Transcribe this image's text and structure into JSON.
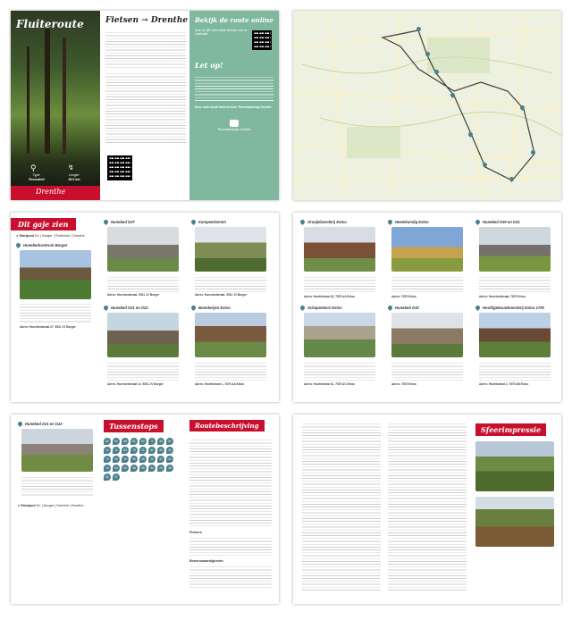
{
  "page1": {
    "cover_title": "Fluiteroute",
    "header_title": "Fietsen → Drenthe",
    "online_title": "Bekijk de route online",
    "online_text": "Scan de QR-code met je telefoon voor de routekaart.",
    "letop_title": "Let op!",
    "green_text": "Deze route wordt beheerd door: Recreatieschap Drenthe",
    "logo_text": "Recreatieschap Drenthe",
    "type_label": "Type:",
    "type_value": "Recreatief",
    "length_label": "Lengte:",
    "length_value": "45.0 km",
    "footer_logo": "Drenthe",
    "colors": {
      "red": "#c8102e",
      "green": "#7fb89f",
      "dark": "#1a1a1a"
    },
    "icons": [
      "bike-icon",
      "route-icon",
      "qr-code"
    ]
  },
  "page3": {
    "title": "Dit gaje zien",
    "start_label": "Startpunt",
    "start_place": "Dr. | Borger | Fluiteilme | Drenthe",
    "items": [
      {
        "title": "Hunebedcentrum Borger",
        "addr": "Adres: Hunebedstraat 27, 9531 JV Borger"
      },
      {
        "title": "Hunebed D27",
        "addr": "Adres: Hunebedstraat, 9531 JV Borger"
      },
      {
        "title": "Kampeerterrein",
        "addr": "Adres: Hunebedstraat, 9531 JV Borger"
      },
      {
        "title": "Hunebed D21 en D22",
        "addr": "Adres: Hunebedstraat 12, 9531 JV Borger"
      },
      {
        "title": "Boerderijen Exloo",
        "addr": "Adres: Hoofdstraat 1, 7875 AA Exloo"
      }
    ]
  },
  "page4": {
    "items": [
      {
        "title": "Oranjeboerderij Exloo",
        "addr": "Adres: Hoofdstraat 32, 7875 AA Exloo"
      },
      {
        "title": "Heemkundig Exloo",
        "addr": "Adres: 7875 Exloo"
      },
      {
        "title": "Hunebed D30 en D31",
        "addr": "Adres: Hunebedstraat, 7875 Exloo"
      },
      {
        "title": "Schapenkooi Exloo",
        "addr": "Adres: Hoofdstraat 31, 7875 AC Exloo"
      },
      {
        "title": "Hunebed D32",
        "addr": "Adres: 7875 Exloo"
      },
      {
        "title": "Hoofdgebouwboerderij Exloo 1700",
        "addr": "Adres: Hoofdstraat 2, 7875 AB Exloo"
      }
    ]
  },
  "page5": {
    "item_title": "Hunebed D21 en D22",
    "eindpunt_label": "Eindpunt",
    "eindpunt_place": "Dr. | Borger | Drenthe | Drenthe",
    "tussenstops_title": "Tussenstops",
    "stops": [
      "62",
      "64",
      "68",
      "61",
      "60",
      "3",
      "45",
      "61",
      "24",
      "71",
      "84",
      "79",
      "21",
      "41",
      "43",
      "34",
      "74",
      "35",
      "19",
      "96",
      "45",
      "12",
      "47",
      "44",
      "14",
      "63",
      "69",
      "38",
      "38",
      "34",
      "26",
      "28",
      "54",
      "37"
    ],
    "beschrijving_title": "Routebeschrijving",
    "sub1": "Fietsers",
    "sub2": "Bezienswaardigheden"
  },
  "page6": {
    "title": "Sfeerimpressie"
  }
}
